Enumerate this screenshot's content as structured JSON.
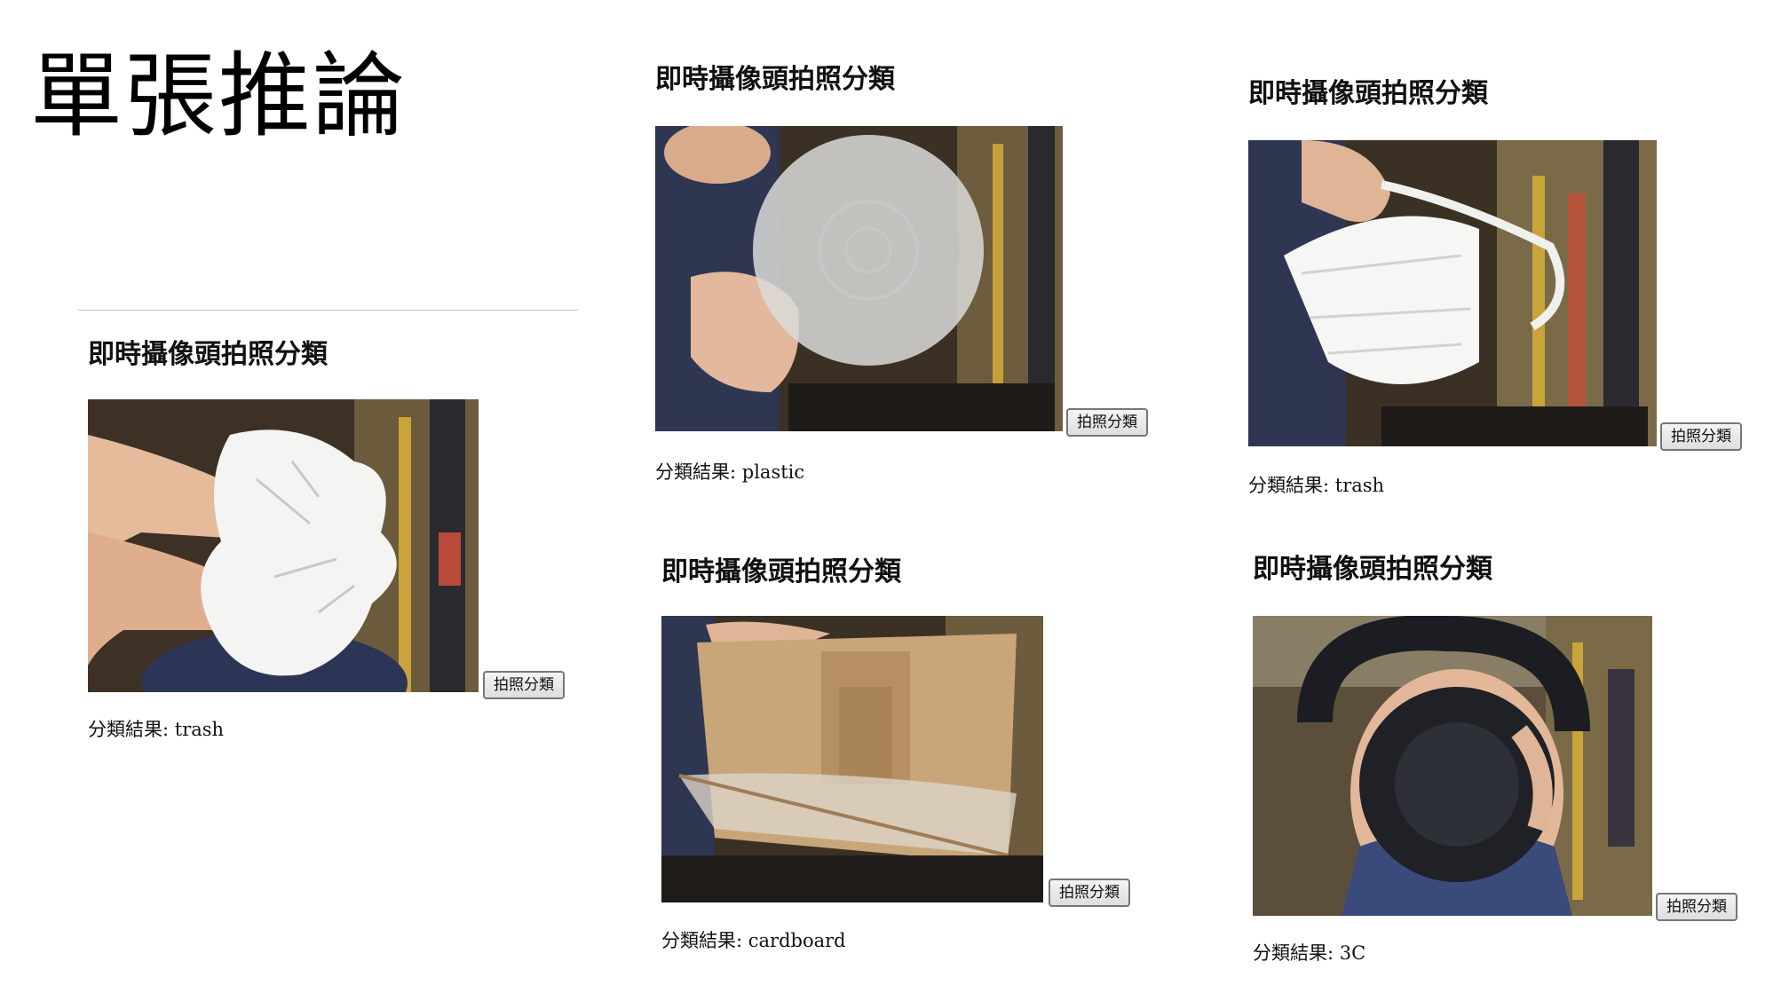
{
  "slide": {
    "title": "單張推論"
  },
  "panels": [
    {
      "id": "panel-tissue",
      "heading": "即時攝像頭拍照分類",
      "button_label": "拍照分類",
      "result_label": "分類結果:",
      "result_value": "trash",
      "video_subject": "crumpled tissue in hand"
    },
    {
      "id": "panel-plastic-lid",
      "heading": "即時攝像頭拍照分類",
      "button_label": "拍照分類",
      "result_label": "分類結果:",
      "result_value": "plastic",
      "video_subject": "clear plastic lid in hand"
    },
    {
      "id": "panel-mask",
      "heading": "即時攝像頭拍照分類",
      "button_label": "拍照分類",
      "result_label": "分類結果:",
      "result_value": "trash",
      "video_subject": "white face mask in hand"
    },
    {
      "id": "panel-cardboard",
      "heading": "即時攝像頭拍照分類",
      "button_label": "拍照分類",
      "result_label": "分類結果:",
      "result_value": "cardboard",
      "video_subject": "cardboard box"
    },
    {
      "id": "panel-headphones",
      "heading": "即時攝像頭拍照分類",
      "button_label": "拍照分類",
      "result_label": "分類結果:",
      "result_value": "3C",
      "video_subject": "black headphones"
    }
  ],
  "colors": {
    "room_background": "#3a3128",
    "paper_white": "#f4f4f2",
    "cardboard": "#c9a57a",
    "skin": "#e8c2a6",
    "headphones": "#1c1d22"
  }
}
